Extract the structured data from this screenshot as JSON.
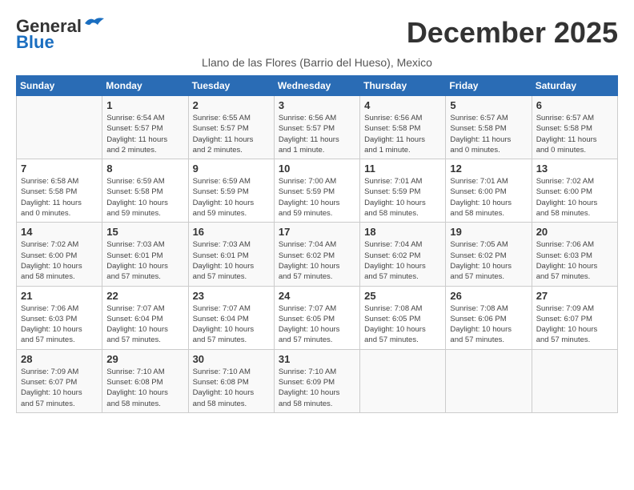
{
  "header": {
    "logo_general": "General",
    "logo_blue": "Blue",
    "month": "December 2025",
    "location": "Llano de las Flores (Barrio del Hueso), Mexico"
  },
  "days_of_week": [
    "Sunday",
    "Monday",
    "Tuesday",
    "Wednesday",
    "Thursday",
    "Friday",
    "Saturday"
  ],
  "weeks": [
    [
      {
        "day": "",
        "info": ""
      },
      {
        "day": "1",
        "info": "Sunrise: 6:54 AM\nSunset: 5:57 PM\nDaylight: 11 hours\nand 2 minutes."
      },
      {
        "day": "2",
        "info": "Sunrise: 6:55 AM\nSunset: 5:57 PM\nDaylight: 11 hours\nand 2 minutes."
      },
      {
        "day": "3",
        "info": "Sunrise: 6:56 AM\nSunset: 5:57 PM\nDaylight: 11 hours\nand 1 minute."
      },
      {
        "day": "4",
        "info": "Sunrise: 6:56 AM\nSunset: 5:58 PM\nDaylight: 11 hours\nand 1 minute."
      },
      {
        "day": "5",
        "info": "Sunrise: 6:57 AM\nSunset: 5:58 PM\nDaylight: 11 hours\nand 0 minutes."
      },
      {
        "day": "6",
        "info": "Sunrise: 6:57 AM\nSunset: 5:58 PM\nDaylight: 11 hours\nand 0 minutes."
      }
    ],
    [
      {
        "day": "7",
        "info": "Sunrise: 6:58 AM\nSunset: 5:58 PM\nDaylight: 11 hours\nand 0 minutes."
      },
      {
        "day": "8",
        "info": "Sunrise: 6:59 AM\nSunset: 5:58 PM\nDaylight: 10 hours\nand 59 minutes."
      },
      {
        "day": "9",
        "info": "Sunrise: 6:59 AM\nSunset: 5:59 PM\nDaylight: 10 hours\nand 59 minutes."
      },
      {
        "day": "10",
        "info": "Sunrise: 7:00 AM\nSunset: 5:59 PM\nDaylight: 10 hours\nand 59 minutes."
      },
      {
        "day": "11",
        "info": "Sunrise: 7:01 AM\nSunset: 5:59 PM\nDaylight: 10 hours\nand 58 minutes."
      },
      {
        "day": "12",
        "info": "Sunrise: 7:01 AM\nSunset: 6:00 PM\nDaylight: 10 hours\nand 58 minutes."
      },
      {
        "day": "13",
        "info": "Sunrise: 7:02 AM\nSunset: 6:00 PM\nDaylight: 10 hours\nand 58 minutes."
      }
    ],
    [
      {
        "day": "14",
        "info": "Sunrise: 7:02 AM\nSunset: 6:00 PM\nDaylight: 10 hours\nand 58 minutes."
      },
      {
        "day": "15",
        "info": "Sunrise: 7:03 AM\nSunset: 6:01 PM\nDaylight: 10 hours\nand 57 minutes."
      },
      {
        "day": "16",
        "info": "Sunrise: 7:03 AM\nSunset: 6:01 PM\nDaylight: 10 hours\nand 57 minutes."
      },
      {
        "day": "17",
        "info": "Sunrise: 7:04 AM\nSunset: 6:02 PM\nDaylight: 10 hours\nand 57 minutes."
      },
      {
        "day": "18",
        "info": "Sunrise: 7:04 AM\nSunset: 6:02 PM\nDaylight: 10 hours\nand 57 minutes."
      },
      {
        "day": "19",
        "info": "Sunrise: 7:05 AM\nSunset: 6:02 PM\nDaylight: 10 hours\nand 57 minutes."
      },
      {
        "day": "20",
        "info": "Sunrise: 7:06 AM\nSunset: 6:03 PM\nDaylight: 10 hours\nand 57 minutes."
      }
    ],
    [
      {
        "day": "21",
        "info": "Sunrise: 7:06 AM\nSunset: 6:03 PM\nDaylight: 10 hours\nand 57 minutes."
      },
      {
        "day": "22",
        "info": "Sunrise: 7:07 AM\nSunset: 6:04 PM\nDaylight: 10 hours\nand 57 minutes."
      },
      {
        "day": "23",
        "info": "Sunrise: 7:07 AM\nSunset: 6:04 PM\nDaylight: 10 hours\nand 57 minutes."
      },
      {
        "day": "24",
        "info": "Sunrise: 7:07 AM\nSunset: 6:05 PM\nDaylight: 10 hours\nand 57 minutes."
      },
      {
        "day": "25",
        "info": "Sunrise: 7:08 AM\nSunset: 6:05 PM\nDaylight: 10 hours\nand 57 minutes."
      },
      {
        "day": "26",
        "info": "Sunrise: 7:08 AM\nSunset: 6:06 PM\nDaylight: 10 hours\nand 57 minutes."
      },
      {
        "day": "27",
        "info": "Sunrise: 7:09 AM\nSunset: 6:07 PM\nDaylight: 10 hours\nand 57 minutes."
      }
    ],
    [
      {
        "day": "28",
        "info": "Sunrise: 7:09 AM\nSunset: 6:07 PM\nDaylight: 10 hours\nand 57 minutes."
      },
      {
        "day": "29",
        "info": "Sunrise: 7:10 AM\nSunset: 6:08 PM\nDaylight: 10 hours\nand 58 minutes."
      },
      {
        "day": "30",
        "info": "Sunrise: 7:10 AM\nSunset: 6:08 PM\nDaylight: 10 hours\nand 58 minutes."
      },
      {
        "day": "31",
        "info": "Sunrise: 7:10 AM\nSunset: 6:09 PM\nDaylight: 10 hours\nand 58 minutes."
      },
      {
        "day": "",
        "info": ""
      },
      {
        "day": "",
        "info": ""
      },
      {
        "day": "",
        "info": ""
      }
    ]
  ]
}
